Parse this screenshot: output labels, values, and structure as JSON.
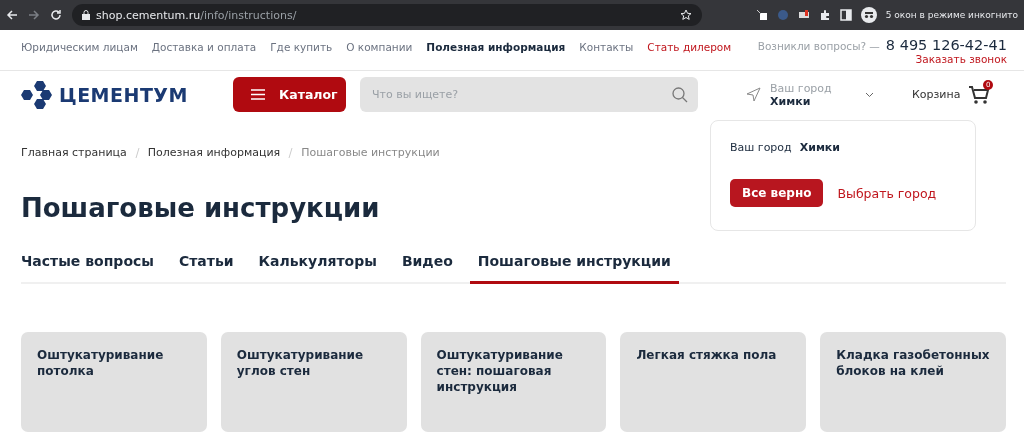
{
  "browser": {
    "url_host": "shop.cementum.ru",
    "url_path": "/info/instructions/",
    "incognito": "5 окон в режиме инкогнито"
  },
  "top_nav": {
    "items": [
      {
        "label": "Юридическим лицам",
        "selected": false,
        "kind": "plain"
      },
      {
        "label": "Доставка и оплата",
        "selected": false,
        "kind": "plain"
      },
      {
        "label": "Где купить",
        "selected": false,
        "kind": "plain"
      },
      {
        "label": "О компании",
        "selected": false,
        "kind": "plain"
      },
      {
        "label": "Полезная информация",
        "selected": true,
        "kind": "plain"
      },
      {
        "label": "Контакты",
        "selected": false,
        "kind": "plain"
      },
      {
        "label": "Стать дилером",
        "selected": false,
        "kind": "accent"
      }
    ],
    "question": "Возникли вопросы? —",
    "phone": "8 495 126-42-41",
    "callback": "Заказать звонок"
  },
  "header": {
    "logo": "ЦЕМЕНТУМ",
    "catalog_button": "Каталог",
    "search": {
      "placeholder": "Что вы ищете?"
    },
    "city_label": "Ваш город",
    "city": "Химки",
    "cart_label": "Корзина",
    "cart_count": "0"
  },
  "city_popup": {
    "label": "Ваш город",
    "city": "Химки",
    "confirm": "Все верно",
    "choose": "Выбрать город"
  },
  "breadcrumbs": [
    {
      "label": "Главная страница",
      "current": false
    },
    {
      "label": "Полезная информация",
      "current": false
    },
    {
      "label": "Пошаговые инструкции",
      "current": true
    }
  ],
  "title": "Пошаговые инструкции",
  "tabs": [
    {
      "label": "Частые вопросы",
      "selected": false
    },
    {
      "label": "Статьи",
      "selected": false
    },
    {
      "label": "Калькуляторы",
      "selected": false
    },
    {
      "label": "Видео",
      "selected": false
    },
    {
      "label": "Пошаговые инструкции",
      "selected": true
    }
  ],
  "cards": [
    {
      "title": "Оштукатуривание потолка"
    },
    {
      "title": "Оштукатуривание углов стен"
    },
    {
      "title": "Оштукатуривание стен: пошаговая инструкция"
    },
    {
      "title": "Легкая стяжка пола"
    },
    {
      "title": "Кладка газобетонных блоков на клей"
    }
  ]
}
